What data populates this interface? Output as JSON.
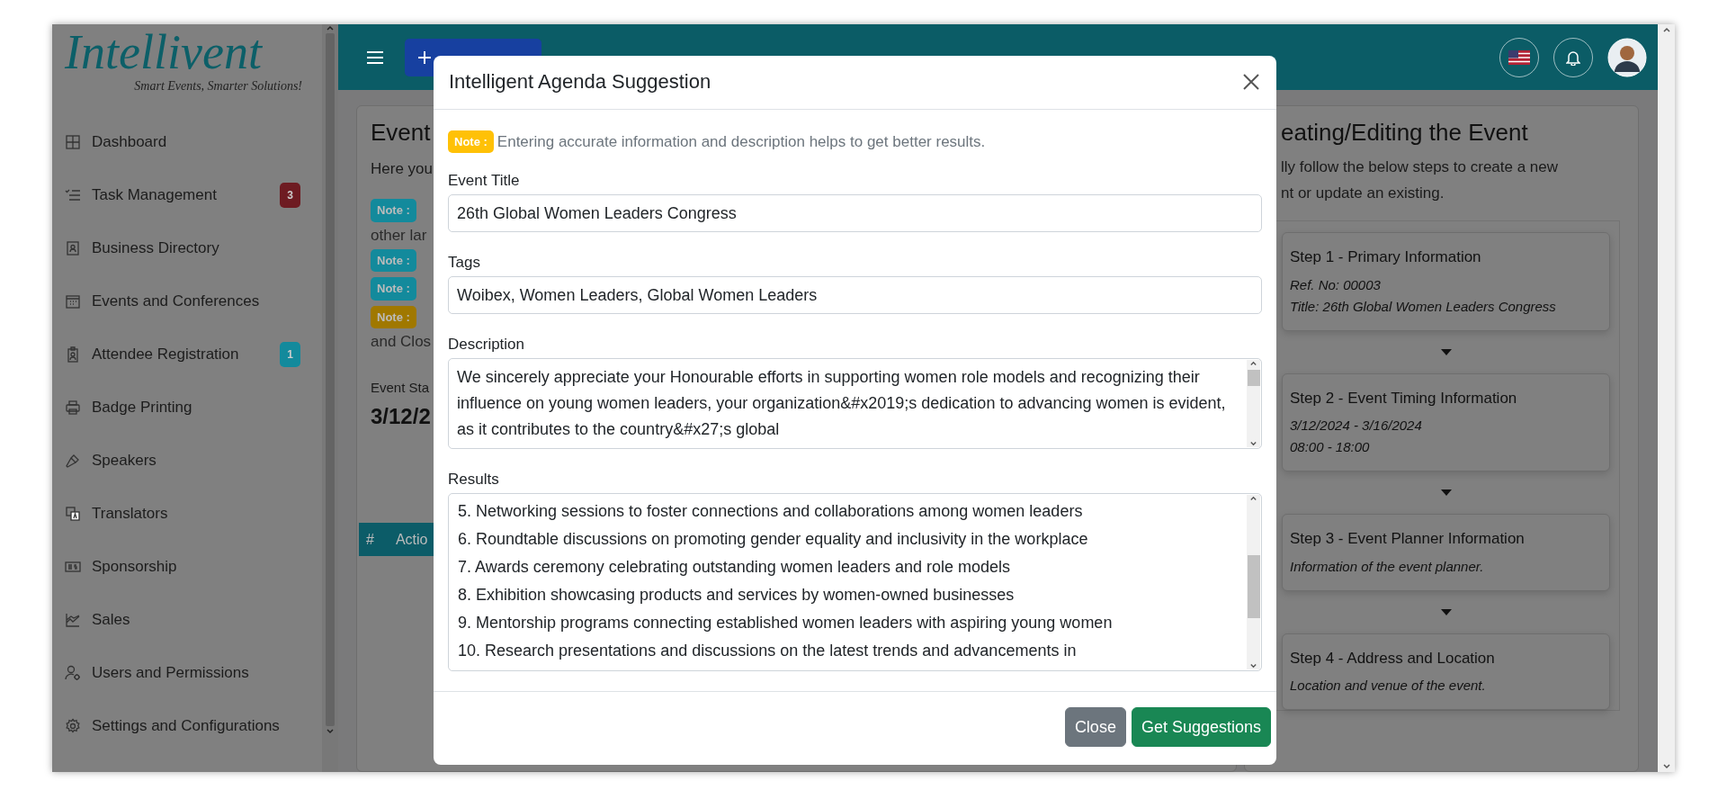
{
  "sidebar": {
    "logo": "Intellivent",
    "tagline": "Smart Events, Smarter Solutions!",
    "items": [
      {
        "label": "Dashboard"
      },
      {
        "label": "Task Management",
        "badge": "3",
        "color": "#6e1b22"
      },
      {
        "label": "Business Directory"
      },
      {
        "label": "Events and Conferences"
      },
      {
        "label": "Attendee Registration",
        "badge": "1",
        "color": "#138a9c"
      },
      {
        "label": "Badge Printing"
      },
      {
        "label": "Speakers"
      },
      {
        "label": "Translators"
      },
      {
        "label": "Sponsorship"
      },
      {
        "label": "Sales"
      },
      {
        "label": "Users and Permissions"
      },
      {
        "label": "Settings and Configurations"
      }
    ]
  },
  "left_card": {
    "title": "Event",
    "intro": "Here you",
    "notes": [
      {
        "badge": "Note :",
        "color": "#138a9c",
        "continuation": "other lar"
      },
      {
        "badge": "Note :",
        "color": "#138a9c"
      },
      {
        "badge": "Note :",
        "color": "#138a9c"
      },
      {
        "badge": "Note :",
        "color": "#a07800",
        "continuation": "and Clos"
      }
    ],
    "start_label": "Event Sta",
    "start_value": "3/12/2",
    "table_columns": [
      "#",
      "Actio"
    ]
  },
  "right_card": {
    "title": "eating/Editing the Event",
    "subtitle_lines": [
      "lly follow the below steps to create a new",
      "nt or update an existing."
    ],
    "steps": [
      {
        "title": "Step 1 - Primary Information",
        "lines": [
          "Ref. No: 00003",
          "Title: 26th Global Women Leaders Congress"
        ]
      },
      {
        "title": "Step 2 - Event Timing Information",
        "lines": [
          "3/12/2024 - 3/16/2024",
          "08:00 - 18:00"
        ]
      },
      {
        "title": "Step 3 - Event Planner Information",
        "lines": [
          "Information of the event planner."
        ]
      },
      {
        "title": "Step 4 - Address and Location",
        "lines": [
          "Location and venue of the event."
        ]
      }
    ]
  },
  "modal": {
    "title": "Intelligent Agenda Suggestion",
    "note": {
      "badge": "Note :",
      "text": "Entering accurate information and description helps to get better results."
    },
    "fields": [
      {
        "kind": "input",
        "label": "Event Title",
        "value": "26th Global Women Leaders Congress"
      },
      {
        "kind": "input",
        "label": "Tags",
        "value": "Woibex, Women Leaders, Global Women Leaders"
      },
      {
        "kind": "textarea",
        "label": "Description",
        "value": "We sincerely appreciate your Honourable efforts in supporting women role models and recognizing their influence on young women leaders, your organization&#x2019;s dedication to advancing women is evident, as it contributes to the country&#x27;s global"
      },
      {
        "kind": "lines",
        "label": "Results",
        "lines": [
          "5. Networking sessions to foster connections and collaborations among women leaders",
          "6. Roundtable discussions on promoting gender equality and inclusivity in the workplace",
          "7. Awards ceremony celebrating outstanding women leaders and role models",
          "8. Exhibition showcasing products and services by women-owned businesses",
          "9. Mentorship programs connecting established women leaders with aspiring young women",
          "10. Research presentations and discussions on the latest trends and advancements in"
        ]
      }
    ],
    "buttons": [
      {
        "label": "Close",
        "kind": "secondary"
      },
      {
        "label": "Get Suggestions",
        "kind": "success"
      }
    ]
  }
}
